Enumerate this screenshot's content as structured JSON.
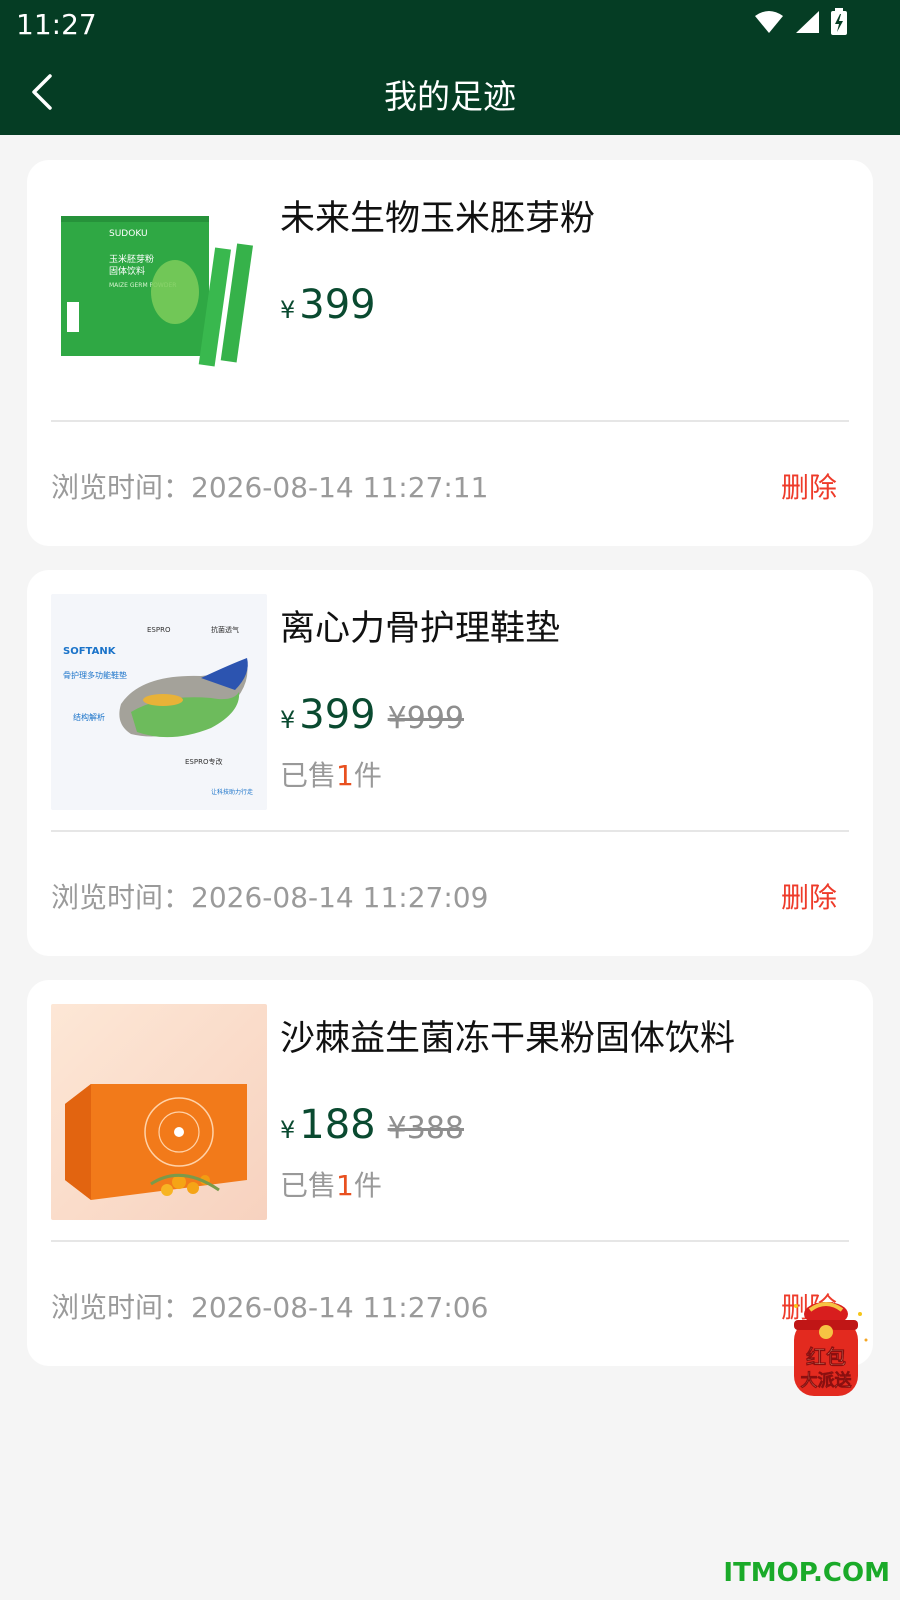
{
  "status": {
    "time": "11:27"
  },
  "header": {
    "title": "我的足迹"
  },
  "items": [
    {
      "name": "未来生物玉米胚芽粉",
      "currency": "¥",
      "price": "399",
      "old_price": "",
      "sold_prefix": "",
      "sold_count": "",
      "sold_suffix": "",
      "browse_label": "浏览时间：",
      "browse_time": "2026-08-14 11:27:11",
      "delete_label": "删除",
      "image_icon": "maize-germ-powder-box-image",
      "image_text": {
        "brand": "SUDOKU",
        "title": "玉米胚芽粉",
        "subtitle": "固体饮料",
        "en": "MAIZE GERM POWDER"
      }
    },
    {
      "name": "离心力骨护理鞋垫",
      "currency": "¥",
      "price": "399",
      "old_price": "¥999",
      "sold_prefix": "已售",
      "sold_count": "1",
      "sold_suffix": "件",
      "browse_label": "浏览时间：",
      "browse_time": "2026-08-14 11:27:09",
      "delete_label": "删除",
      "image_icon": "insole-image",
      "image_text": {
        "brand": "SOFTANK",
        "tagline": "骨护理多功能鞋垫",
        "section": "结构解析",
        "f1": "ESPRO",
        "f2": "抗菌透气",
        "f3": "ESPRO专改",
        "footer": "让科技助力行走"
      }
    },
    {
      "name": "沙棘益生菌冻干果粉固体饮料",
      "currency": "¥",
      "price": "188",
      "old_price": "¥388",
      "sold_prefix": "已售",
      "sold_count": "1",
      "sold_suffix": "件",
      "browse_label": "浏览时间：",
      "browse_time": "2026-08-14 11:27:06",
      "delete_label": "删除",
      "image_icon": "sea-buckthorn-box-image",
      "image_text": {}
    }
  ],
  "floating": {
    "label_line1": "红包",
    "label_line2": "大派送",
    "icon": "red-packet-icon"
  },
  "watermark": "ITMOP.COM",
  "colors": {
    "header_bg": "#053d24",
    "price": "#0a4a30",
    "delete": "#ee3b2a",
    "sold_count": "#e8501f"
  }
}
